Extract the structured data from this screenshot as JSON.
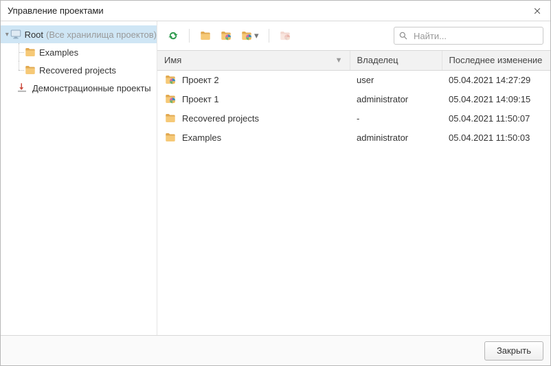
{
  "window": {
    "title": "Управление проектами",
    "close_button": "close"
  },
  "sidebar": {
    "root": {
      "label": "Root",
      "hint": "(Все хранилища проектов)"
    },
    "children": [
      {
        "label": "Examples"
      },
      {
        "label": "Recovered projects"
      }
    ],
    "demo": {
      "label": "Демонстрационные проекты"
    }
  },
  "toolbar": {
    "refresh": "refresh",
    "new_folder": "new-folder",
    "new_project": "new-project",
    "import_project": "import-project",
    "delete": "delete",
    "search_placeholder": "Найти..."
  },
  "table": {
    "columns": {
      "name": "Имя",
      "owner": "Владелец",
      "modified": "Последнее изменение"
    },
    "rows": [
      {
        "icon": "project",
        "name": "Проект 2",
        "owner": "user",
        "modified": "05.04.2021 14:27:29"
      },
      {
        "icon": "project",
        "name": "Проект 1",
        "owner": "administrator",
        "modified": "05.04.2021 14:09:15"
      },
      {
        "icon": "folder",
        "name": "Recovered projects",
        "owner": "-",
        "modified": "05.04.2021 11:50:07"
      },
      {
        "icon": "folder",
        "name": "Examples",
        "owner": "administrator",
        "modified": "05.04.2021 11:50:03"
      }
    ]
  },
  "footer": {
    "close_label": "Закрыть"
  }
}
